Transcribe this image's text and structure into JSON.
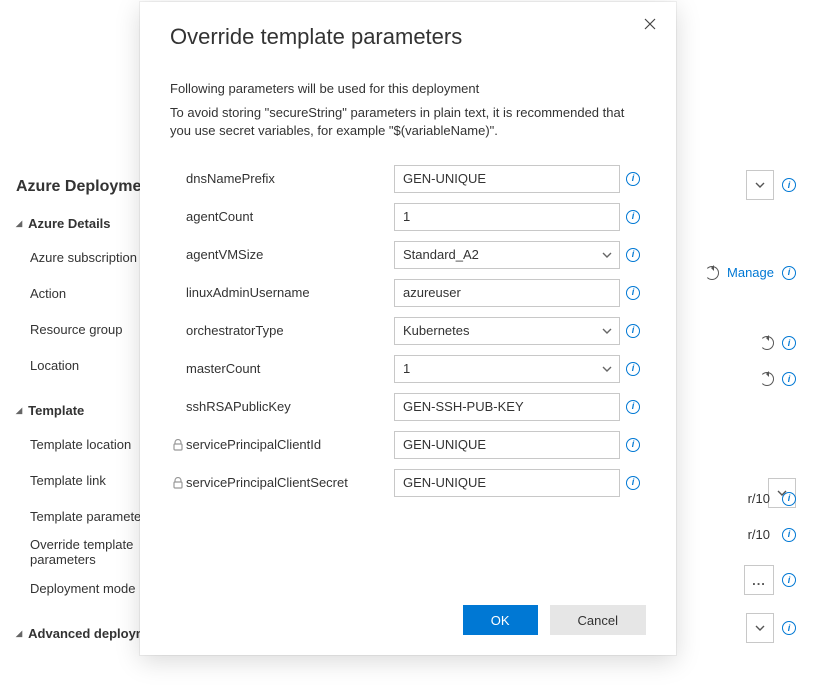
{
  "background": {
    "heading": "Azure Deployment",
    "sections": {
      "azureDetails": {
        "title": "Azure Details",
        "rows": [
          {
            "label": "Azure subscription"
          },
          {
            "label": "Action"
          },
          {
            "label": "Resource group"
          },
          {
            "label": "Location"
          }
        ]
      },
      "template": {
        "title": "Template",
        "rows": [
          {
            "label": "Template location"
          },
          {
            "label": "Template link"
          },
          {
            "label": "Template parameters"
          },
          {
            "label": "Override template parameters"
          },
          {
            "label": "Deployment mode"
          }
        ]
      },
      "advanced": {
        "title": "Advanced deployment"
      }
    },
    "trails": {
      "manage": "Manage",
      "r10a": "r/10",
      "r10b": "r/10",
      "ellipsis": "..."
    }
  },
  "modal": {
    "title": "Override template parameters",
    "desc1": "Following parameters will be used for this deployment",
    "desc2": "To avoid storing \"secureString\" parameters in plain text, it is recommended that you use secret variables, for example \"$(variableName)\".",
    "params": [
      {
        "label": "dnsNamePrefix",
        "value": "GEN-UNIQUE",
        "type": "text",
        "locked": false
      },
      {
        "label": "agentCount",
        "value": "1",
        "type": "text",
        "locked": false
      },
      {
        "label": "agentVMSize",
        "value": "Standard_A2",
        "type": "select",
        "locked": false
      },
      {
        "label": "linuxAdminUsername",
        "value": "azureuser",
        "type": "text",
        "locked": false
      },
      {
        "label": "orchestratorType",
        "value": "Kubernetes",
        "type": "select",
        "locked": false
      },
      {
        "label": "masterCount",
        "value": "1",
        "type": "select",
        "locked": false
      },
      {
        "label": "sshRSAPublicKey",
        "value": "GEN-SSH-PUB-KEY",
        "type": "text",
        "locked": false
      },
      {
        "label": "servicePrincipalClientId",
        "value": "GEN-UNIQUE",
        "type": "text",
        "locked": true
      },
      {
        "label": "servicePrincipalClientSecret",
        "value": "GEN-UNIQUE",
        "type": "text",
        "locked": true
      }
    ],
    "buttons": {
      "ok": "OK",
      "cancel": "Cancel"
    }
  }
}
